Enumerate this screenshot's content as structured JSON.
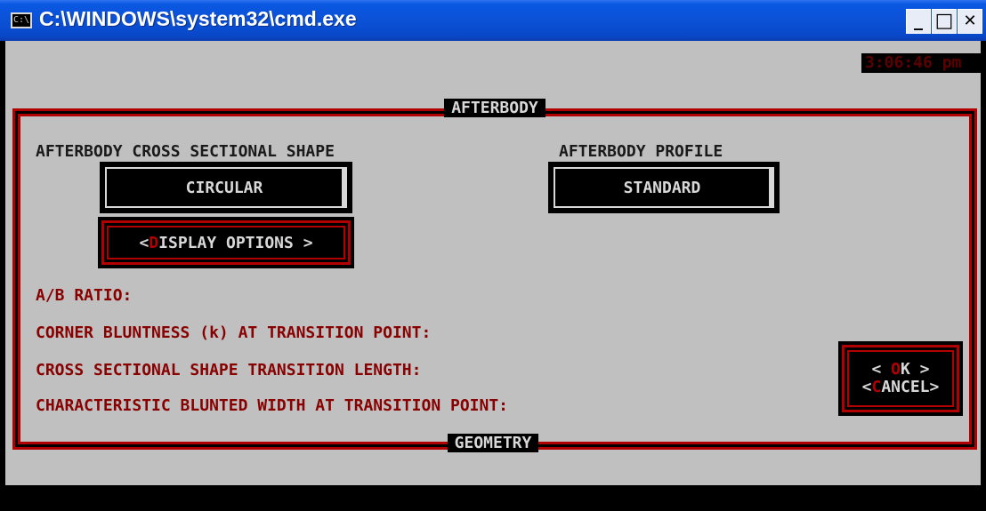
{
  "window": {
    "title": "C:\\WINDOWS\\system32\\cmd.exe",
    "icon_text": "C:\\",
    "buttons": {
      "minimize": "_",
      "maximize": "□",
      "close": "✕"
    }
  },
  "clock": "3:06:46 pm",
  "panel": {
    "title": "AFTERBODY",
    "bottom_title": "GEOMETRY"
  },
  "cross_section": {
    "label": "AFTERBODY CROSS SECTIONAL SHAPE",
    "value": "CIRCULAR"
  },
  "profile": {
    "label": "AFTERBODY PROFILE",
    "value": "STANDARD"
  },
  "display_options": {
    "left": "< ",
    "hotkey": "D",
    "rest": "ISPLAY OPTIONS >"
  },
  "fields": {
    "ab_ratio": "A/B RATIO:",
    "corner_bluntness": "CORNER BLUNTNESS (k) AT TRANSITION POINT:",
    "transition_length": "CROSS SECTIONAL SHAPE TRANSITION LENGTH:",
    "blunted_width": "CHARACTERISTIC BLUNTED WIDTH AT TRANSITION POINT:"
  },
  "ok_button": {
    "left": "<  ",
    "hotkey": "O",
    "rest": "K  >"
  },
  "cancel_button": {
    "left": "<",
    "hotkey": "C",
    "rest": "ANCEL>"
  },
  "colors": {
    "console_bg": "#c0c0c0",
    "frame_red": "#b00000",
    "label_red": "#880000",
    "title_blue": "#0b51d6"
  }
}
